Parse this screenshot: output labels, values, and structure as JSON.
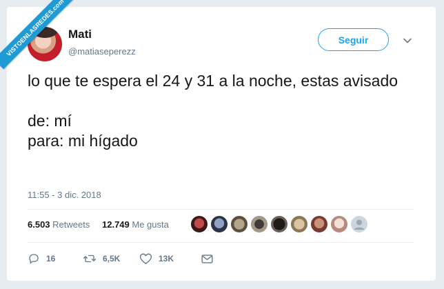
{
  "watermark": "VISTOENLASREDES",
  "watermark_sub": ".com",
  "user": {
    "name": "Mati",
    "handle": "@matiaseperezz"
  },
  "follow_label": "Seguir",
  "tweet_text": "lo que te espera el 24 y 31 a la noche, estas avisado\n\nde: mí\npara: mi hígado",
  "timestamp": "11:55 - 3 dic. 2018",
  "stats": {
    "retweets_count": "6.503",
    "retweets_label": "Retweets",
    "likes_count": "12.749",
    "likes_label": "Me gusta"
  },
  "liker_avatars": [
    "avatar-1",
    "avatar-2",
    "avatar-3",
    "avatar-4",
    "avatar-5",
    "avatar-6",
    "avatar-7",
    "avatar-8",
    "avatar-9"
  ],
  "actions": {
    "replies": "16",
    "retweets": "6,5K",
    "likes": "13K"
  },
  "colors": {
    "accent": "#1da1f2",
    "text": "#14171a",
    "muted": "#657786",
    "watermark": "#1d9bd7"
  }
}
